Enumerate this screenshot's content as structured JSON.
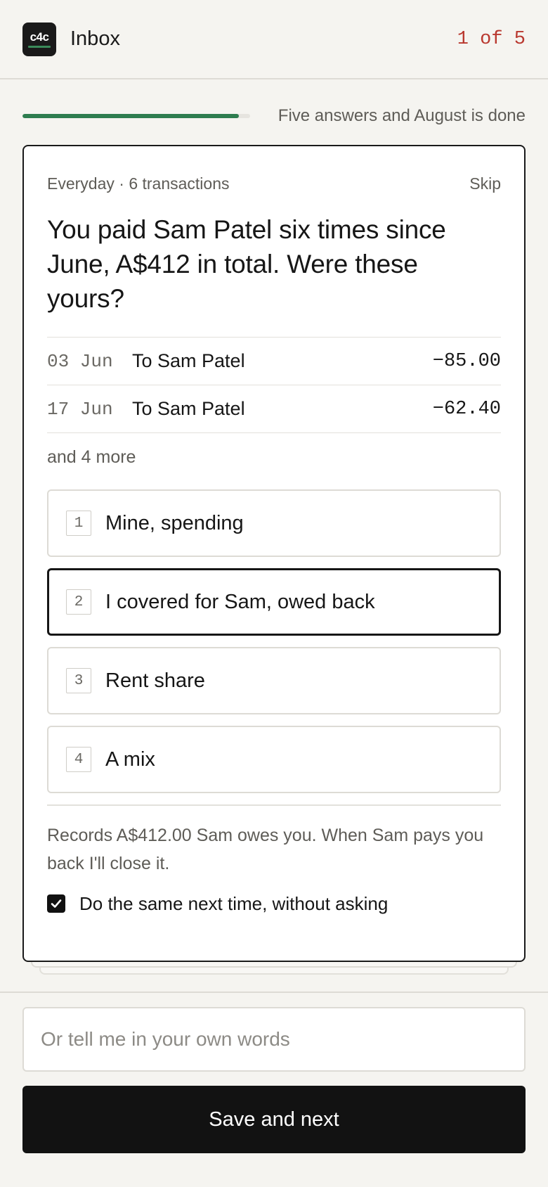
{
  "header": {
    "logo_text": "c4c",
    "title": "Inbox",
    "counter": "1 of 5"
  },
  "progress": {
    "fraction": 0.95,
    "label": "Five answers and August is done"
  },
  "card": {
    "meta": "Everyday · 6 transactions",
    "skip_label": "Skip",
    "question": "You paid Sam Patel six times since June, A$412 in total. Were these yours?",
    "transactions": [
      {
        "date": "03 Jun",
        "description": "To Sam Patel",
        "amount": "−85.00"
      },
      {
        "date": "17 Jun",
        "description": "To Sam Patel",
        "amount": "−62.40"
      }
    ],
    "more_label": "and 4 more",
    "options": [
      {
        "num": "1",
        "label": "Mine, spending",
        "selected": false
      },
      {
        "num": "2",
        "label": "I covered for Sam, owed back",
        "selected": true
      },
      {
        "num": "3",
        "label": "Rent share",
        "selected": false
      },
      {
        "num": "4",
        "label": "A mix",
        "selected": false
      }
    ],
    "explanation": "Records A$412.00 Sam owes you. When Sam pays you back I'll close it.",
    "remember_label": "Do the same next time, without asking",
    "remember_checked": true
  },
  "input": {
    "value": "",
    "placeholder": "Or tell me in your own words"
  },
  "save_button_label": "Save and next",
  "colors": {
    "accent_green": "#2e7d4f",
    "counter_red": "#b9382f",
    "primary_dark": "#121212",
    "background": "#f5f4f0"
  }
}
